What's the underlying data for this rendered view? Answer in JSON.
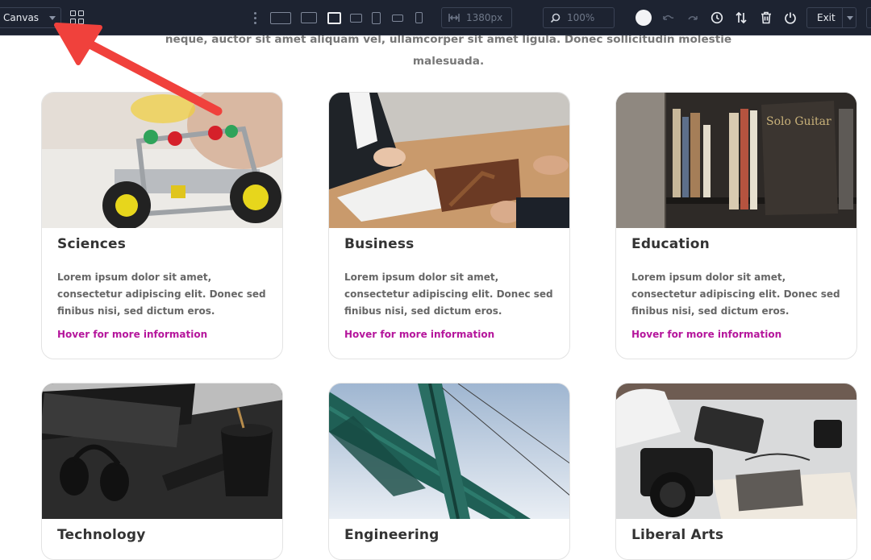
{
  "toolbar": {
    "canvas_label": "Canvas",
    "width_value": "1380px",
    "zoom_value": "100%",
    "exit_label": "Exit"
  },
  "intro_text": "neque, auctor sit amet aliquam vel, ullamcorper sit amet ligula. Donec sollicitudin molestie malesuada.",
  "cards": [
    {
      "title": "Sciences",
      "body": "Lorem ipsum dolor sit amet, consectetur adipiscing elit. Donec sed finibus nisi, sed dictum eros.",
      "link": "Hover for more information"
    },
    {
      "title": "Business",
      "body": "Lorem ipsum dolor sit amet, consectetur adipiscing elit. Donec sed finibus nisi, sed dictum eros.",
      "link": "Hover for more information"
    },
    {
      "title": "Education",
      "body": "Lorem ipsum dolor sit amet, consectetur adipiscing elit. Donec sed finibus nisi, sed dictum eros.",
      "link": "Hover for more information"
    },
    {
      "title": "Technology"
    },
    {
      "title": "Engineering"
    },
    {
      "title": "Liberal Arts"
    }
  ],
  "colors": {
    "toolbar_bg": "#1d2331",
    "link": "#b5169c",
    "annotation_arrow": "#f0413c"
  }
}
